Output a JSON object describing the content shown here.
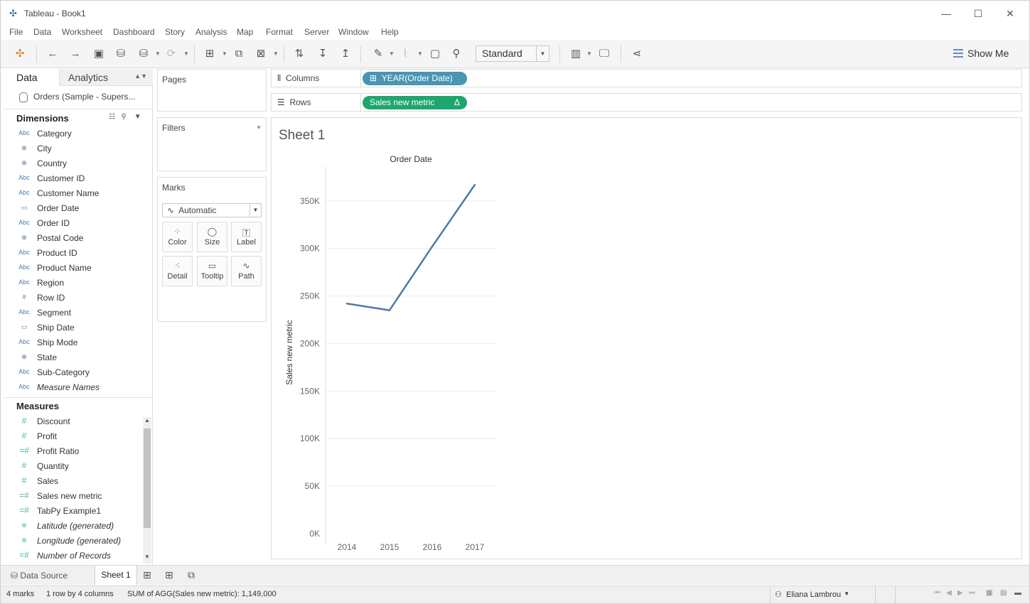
{
  "window": {
    "title": "Tableau - Book1",
    "minimize": "—",
    "maximize": "☐",
    "close": "✕"
  },
  "menu": [
    "File",
    "Data",
    "Worksheet",
    "Dashboard",
    "Story",
    "Analysis",
    "Map",
    "Format",
    "Server",
    "Window",
    "Help"
  ],
  "toolbar": {
    "fit_value": "Standard",
    "show_me_label": "Show Me"
  },
  "data_pane": {
    "tab_data": "Data",
    "tab_analytics": "Analytics",
    "data_source_name": "Orders (Sample - Supers...",
    "dimensions_title": "Dimensions",
    "measures_title": "Measures",
    "dimensions": [
      {
        "icon": "Abc",
        "name": "Category"
      },
      {
        "icon": "⊕",
        "name": "City"
      },
      {
        "icon": "⊕",
        "name": "Country"
      },
      {
        "icon": "Abc",
        "name": "Customer ID"
      },
      {
        "icon": "Abc",
        "name": "Customer Name"
      },
      {
        "icon": "▭",
        "name": "Order Date"
      },
      {
        "icon": "Abc",
        "name": "Order ID"
      },
      {
        "icon": "⊕",
        "name": "Postal Code"
      },
      {
        "icon": "Abc",
        "name": "Product ID"
      },
      {
        "icon": "Abc",
        "name": "Product Name"
      },
      {
        "icon": "Abc",
        "name": "Region"
      },
      {
        "icon": "#",
        "name": "Row ID"
      },
      {
        "icon": "Abc",
        "name": "Segment"
      },
      {
        "icon": "▭",
        "name": "Ship Date"
      },
      {
        "icon": "Abc",
        "name": "Ship Mode"
      },
      {
        "icon": "⊕",
        "name": "State"
      },
      {
        "icon": "Abc",
        "name": "Sub-Category"
      },
      {
        "icon": "Abc",
        "name": "Measure Names"
      }
    ],
    "measures": [
      {
        "icon": "#",
        "name": "Discount"
      },
      {
        "icon": "#",
        "name": "Profit"
      },
      {
        "icon": "=#",
        "name": "Profit Ratio"
      },
      {
        "icon": "#",
        "name": "Quantity"
      },
      {
        "icon": "#",
        "name": "Sales"
      },
      {
        "icon": "=#",
        "name": "Sales new metric"
      },
      {
        "icon": "=#",
        "name": "TabPy Example1"
      },
      {
        "icon": "⊕",
        "name": "Latitude (generated)"
      },
      {
        "icon": "⊕",
        "name": "Longitude (generated)"
      },
      {
        "icon": "=#",
        "name": "Number of Records"
      }
    ]
  },
  "cards": {
    "pages": "Pages",
    "filters": "Filters",
    "marks": "Marks",
    "mark_type": "Automatic",
    "buttons": [
      "Color",
      "Size",
      "Label",
      "Detail",
      "Tooltip",
      "Path"
    ]
  },
  "shelves": {
    "columns_label": "Columns",
    "columns_pill": "YEAR(Order Date)",
    "rows_label": "Rows",
    "rows_pill": "Sales new metric",
    "rows_pill_delta": "Δ"
  },
  "view": {
    "sheet_title": "Sheet 1"
  },
  "chart_data": {
    "type": "line",
    "title": "Order Date",
    "xlabel": "",
    "ylabel": "Sales new metric",
    "categories": [
      "2014",
      "2015",
      "2016",
      "2017"
    ],
    "series": [
      {
        "values": [
          242000,
          235000,
          302000,
          367000
        ],
        "color": "#4e79a7"
      }
    ],
    "ylim": [
      0,
      370000
    ],
    "yticks": [
      0,
      50000,
      100000,
      150000,
      200000,
      250000,
      300000,
      350000
    ],
    "ytick_labels": [
      "0K",
      "50K",
      "100K",
      "150K",
      "200K",
      "250K",
      "300K",
      "350K"
    ],
    "grid": true
  },
  "bottom_tabs": {
    "data_source": "Data Source",
    "sheet": "Sheet 1"
  },
  "status": {
    "marks": "4 marks",
    "rows_cols": "1 row by 4 columns",
    "sum": "SUM of AGG(Sales new metric): 1,149,000",
    "user": "Eliana Lambrou"
  }
}
